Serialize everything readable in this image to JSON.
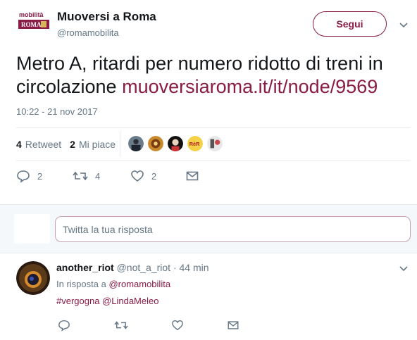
{
  "tweet": {
    "display_name": "Muoversi a Roma",
    "screen_name": "@romamobilita",
    "logo_text": "mobilità ROMA",
    "follow_label": "Segui",
    "text_main": "Metro A, ritardi per numero ridotto di treni in circolazione ",
    "text_link": "muoversiaroma.it/it/node/9569",
    "timestamp": "10:22 - 21 nov 2017",
    "retweet_count": "4",
    "retweet_label": "Retweet",
    "like_count": "2",
    "like_label": "Mi piace",
    "actions": {
      "reply_count": "2",
      "retweet_count": "4",
      "like_count": "2"
    },
    "likers_count": 5
  },
  "compose": {
    "placeholder": "Twitta la tua risposta"
  },
  "reply": {
    "display_name": "another_riot",
    "screen_name": "@not_a_riot",
    "separator": "·",
    "time": "44 min",
    "in_reply_prefix": "In risposta a ",
    "in_reply_mention": "@romamobilita",
    "body": "#vergogna @LindaMeleo"
  },
  "colors": {
    "accent": "#8a1c45",
    "muted": "#657786",
    "text": "#14171a",
    "border": "#e6ecf0"
  }
}
